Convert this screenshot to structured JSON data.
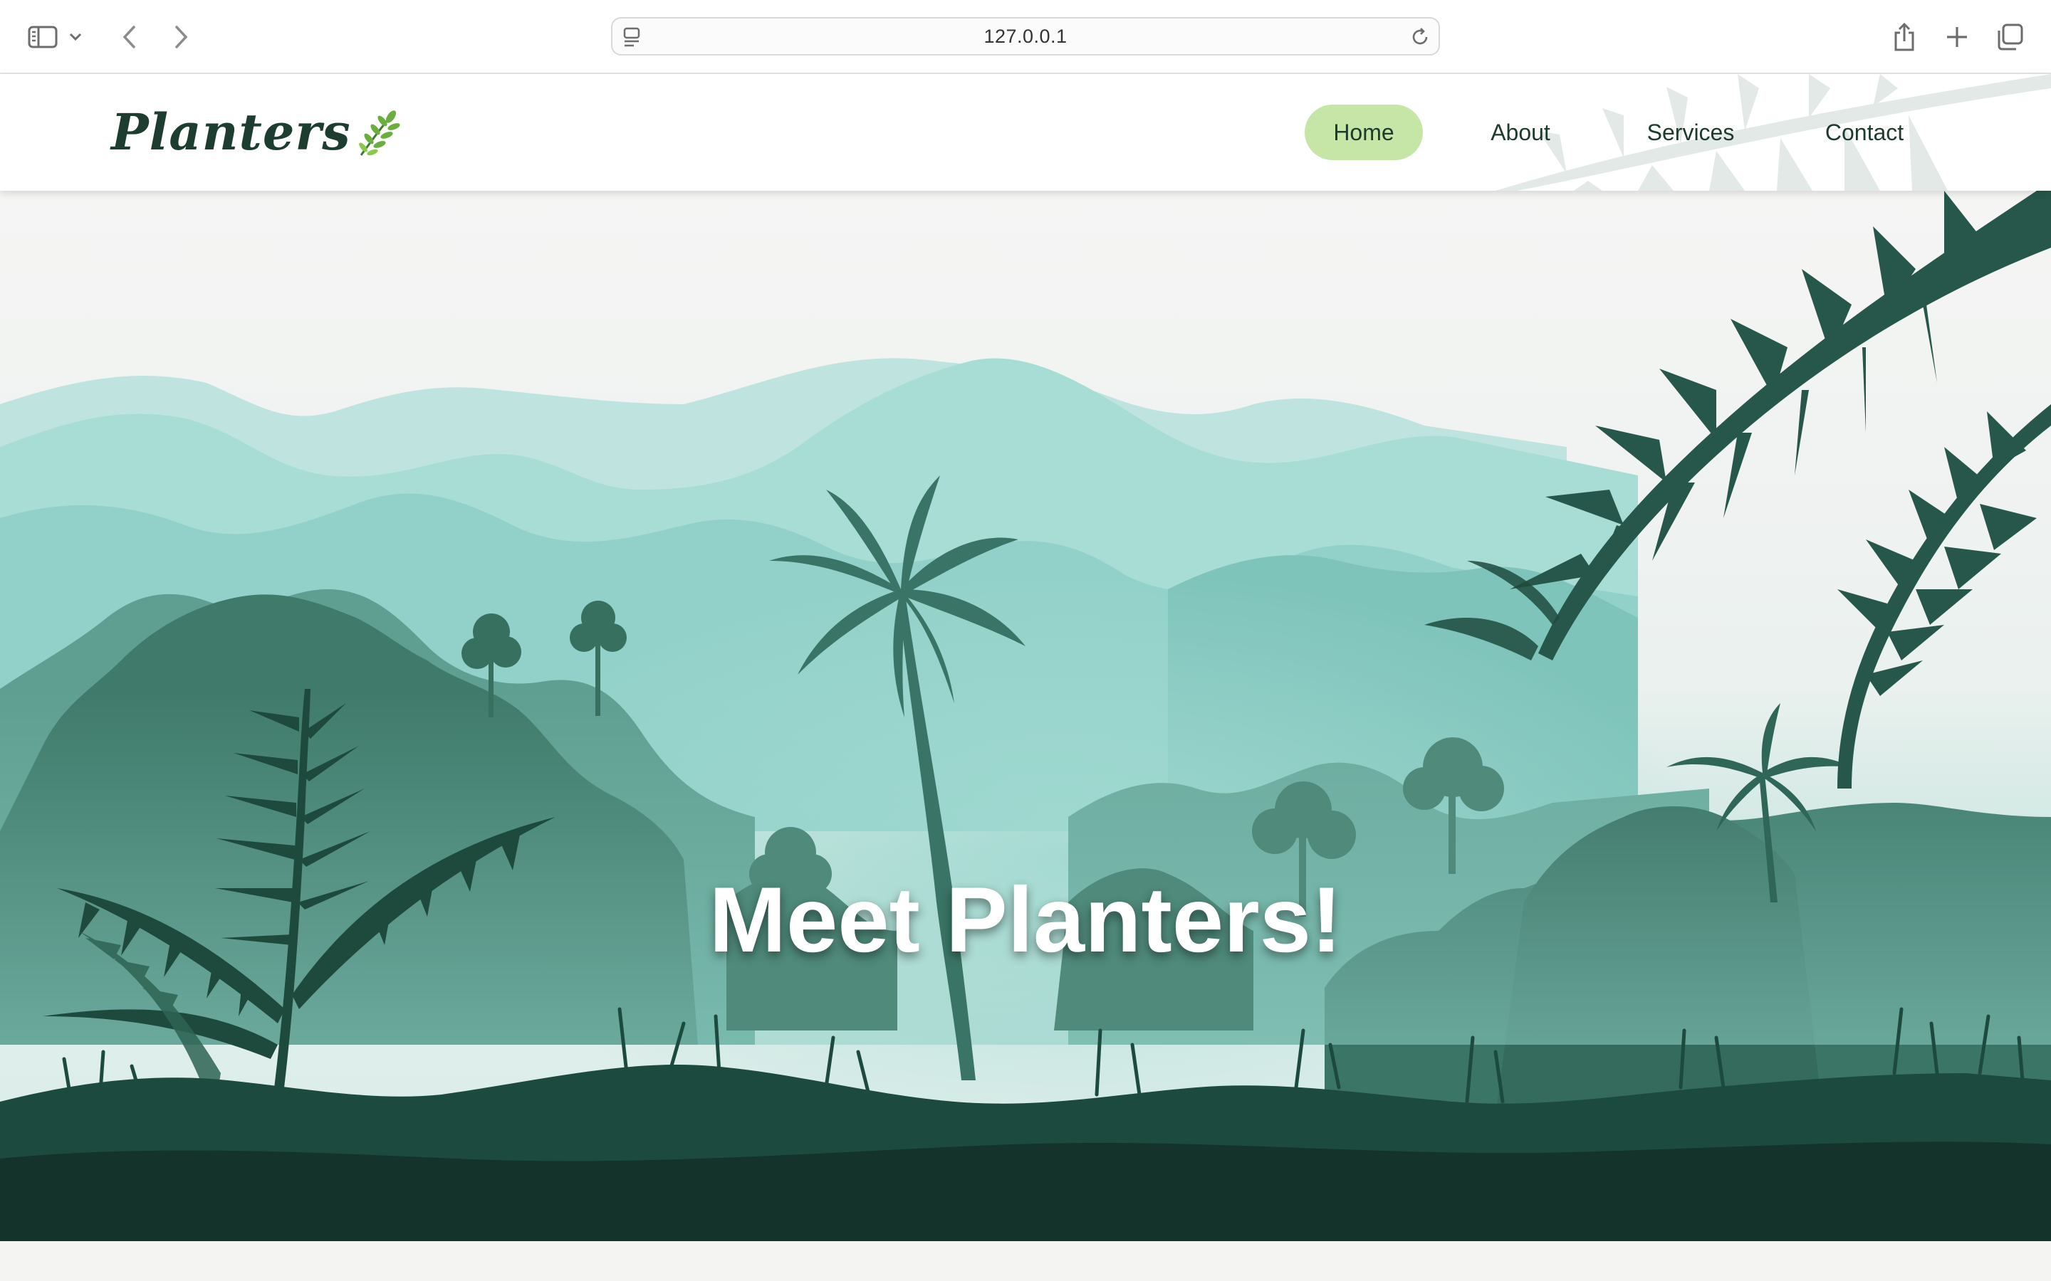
{
  "browser": {
    "url": "127.0.0.1",
    "icons": [
      "sidebar-icon",
      "chevron-down-icon",
      "back-arrow-icon",
      "forward-arrow-icon",
      "site-settings-icon",
      "reload-icon",
      "share-icon",
      "new-tab-icon",
      "tabs-overview-icon"
    ]
  },
  "site": {
    "logo": "Planters",
    "nav": [
      {
        "label": "Home",
        "active": true
      },
      {
        "label": "About",
        "active": false
      },
      {
        "label": "Services",
        "active": false
      },
      {
        "label": "Contact",
        "active": false
      }
    ]
  },
  "hero": {
    "title": "Meet Planters!"
  },
  "colors": {
    "brand_dark": "#1c3d2f",
    "nav_active_bg": "#c6e6a8",
    "hero_ground": "#14332b",
    "mountain_light": "#bfe4df",
    "mountain_mid": "#92d1c9"
  }
}
